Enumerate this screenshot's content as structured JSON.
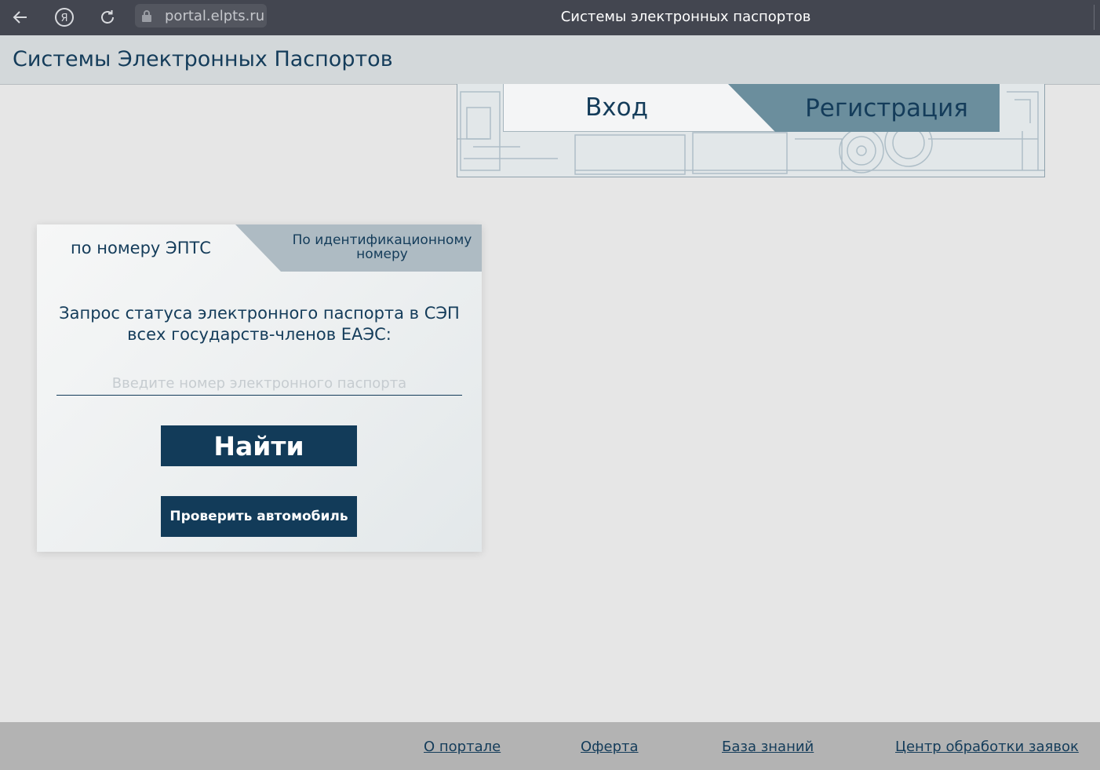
{
  "browser": {
    "url": "portal.elpts.ru",
    "tab_title": "Системы электронных паспортов",
    "yandex_label": "Я"
  },
  "site": {
    "title": "Системы Электронных Паспортов"
  },
  "auth": {
    "login_label": "Вход",
    "register_label": "Регистрация"
  },
  "card": {
    "tab_active": "по номеру ЭПТС",
    "tab_inactive": "По идентификационному номеру",
    "heading": "Запрос статуса электронного паспорта в СЭП всех государств-членов ЕАЭС:",
    "input_placeholder": "Введите номер электронного паспорта",
    "input_value": "",
    "find_button": "Найти",
    "check_button": "Проверить автомобиль"
  },
  "footer": {
    "links": [
      "О портале",
      "Оферта",
      "База знаний",
      "Центр обработки заявок"
    ]
  },
  "colors": {
    "brand_dark": "#123b59",
    "browser_bar": "#434650",
    "header_bg": "#d3d8da",
    "register_tab": "#6b8e9d",
    "inactive_tab": "#aebbc3",
    "footer_bg": "#b3b3b3"
  }
}
